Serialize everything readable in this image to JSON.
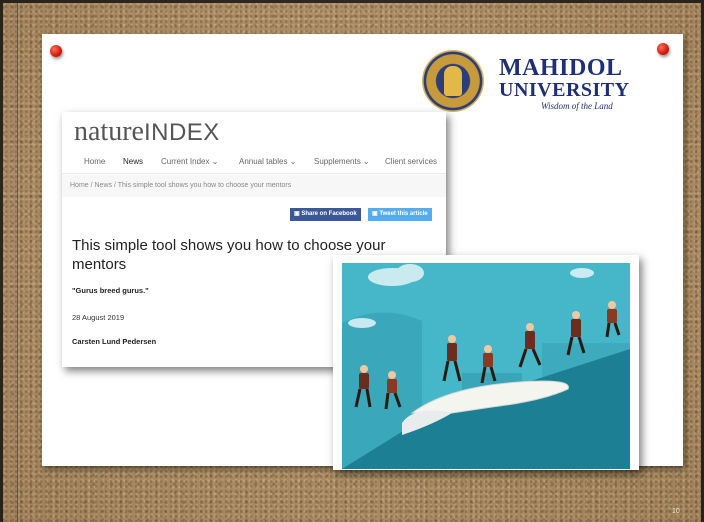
{
  "slide": {
    "page_number": "10",
    "logo": {
      "name_line1": "MAHIDOL",
      "name_line2": "UNIVERSITY",
      "motto": "Wisdom of the Land"
    }
  },
  "article": {
    "brand_nature": "nature",
    "brand_index": "INDEX",
    "nav": {
      "home": "Home",
      "news": "News",
      "current_index": "Current Index ⌄",
      "annual_tables": "Annual tables ⌄",
      "supplements": "Supplements ⌄",
      "client_services": "Client services"
    },
    "breadcrumb": "Home  /  News  /  This simple tool shows you how to choose your mentors",
    "share_facebook": "Share on Facebook",
    "tweet": "Tweet this article",
    "headline": "This simple tool shows you how to choose your mentors",
    "quote": "\"Gurus breed gurus.\"",
    "date": "28 August 2019",
    "author": "Carsten Lund Pedersen"
  },
  "colors": {
    "slide_background": "#ffffff",
    "university_blue": "#1f2f74",
    "pin_red": "#d11a0a",
    "facebook_blue": "#3b5998",
    "twitter_blue": "#55acee",
    "illustration_sky": "#45b7c9"
  }
}
